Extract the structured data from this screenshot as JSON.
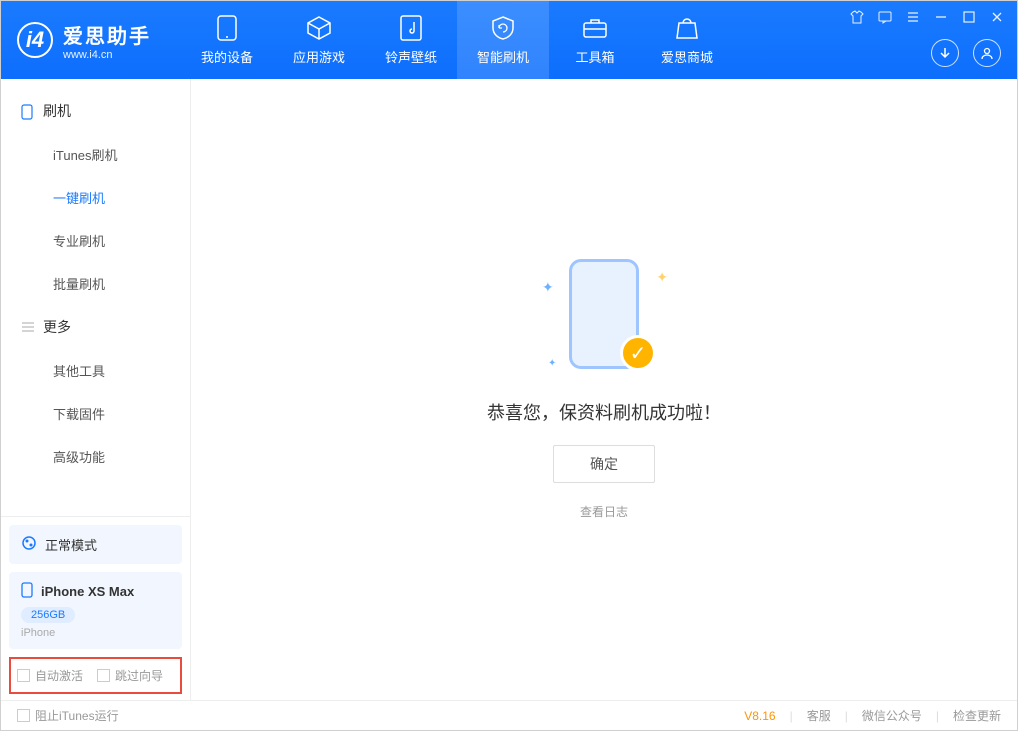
{
  "app": {
    "title": "爱思助手",
    "subtitle": "www.i4.cn"
  },
  "tabs": {
    "device": "我的设备",
    "apps": "应用游戏",
    "ringtone": "铃声壁纸",
    "flash": "智能刷机",
    "toolbox": "工具箱",
    "store": "爱思商城"
  },
  "sidebar": {
    "group1": {
      "title": "刷机",
      "items": [
        "iTunes刷机",
        "一键刷机",
        "专业刷机",
        "批量刷机"
      ]
    },
    "group2": {
      "title": "更多",
      "items": [
        "其他工具",
        "下载固件",
        "高级功能"
      ]
    }
  },
  "mode": {
    "label": "正常模式"
  },
  "device": {
    "name": "iPhone XS Max",
    "capacity": "256GB",
    "type": "iPhone"
  },
  "checks": {
    "auto_activate": "自动激活",
    "skip_guide": "跳过向导"
  },
  "main": {
    "result_text": "恭喜您，保资料刷机成功啦！",
    "ok_button": "确定",
    "log_link": "查看日志"
  },
  "status": {
    "block_itunes": "阻止iTunes运行",
    "version": "V8.16",
    "support": "客服",
    "wechat": "微信公众号",
    "update": "检查更新"
  }
}
